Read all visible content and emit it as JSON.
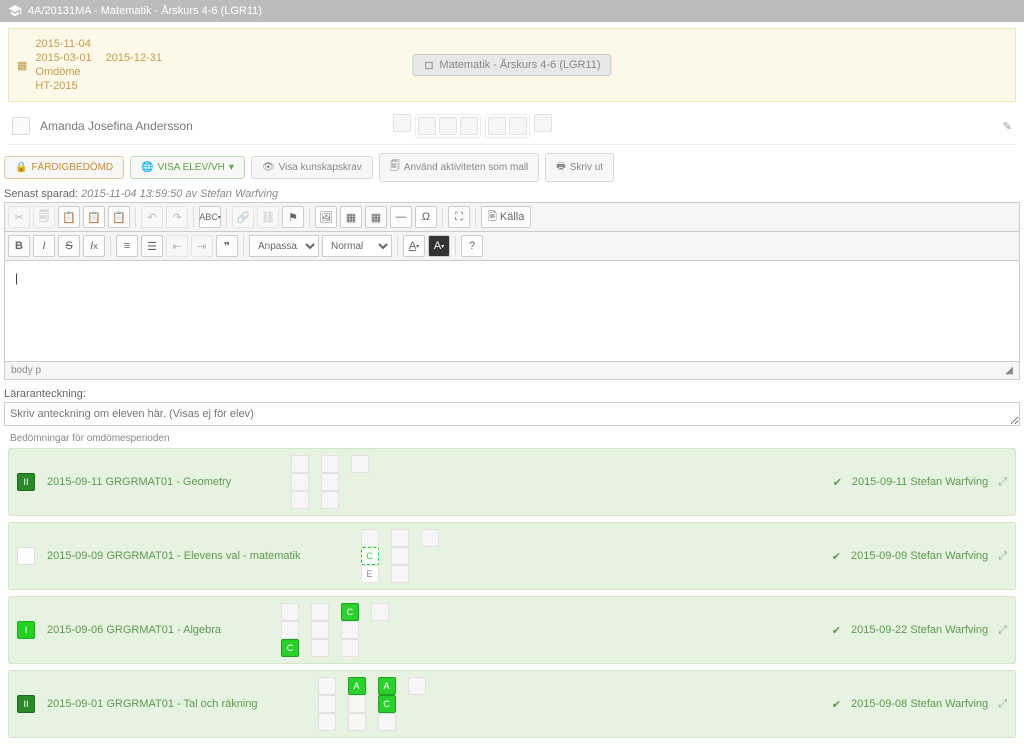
{
  "breadcrumb": "4A/20131MA - Matematik - Årskurs 4-6 (LGR11)",
  "info": {
    "line1": "2015-11-04",
    "line2a": "2015-03-01",
    "line2b": "2015-12-31",
    "line3": "Omdöme",
    "line4": "HT-2015",
    "subject": "Matematik - Årskurs 4-6 (LGR11)"
  },
  "student": {
    "name": "Amanda Josefina Andersson"
  },
  "buttons": {
    "done": "FÄRDIGBEDÖMD",
    "show": "VISA ELEV/VH",
    "reqs": "Visa kunskapskrav",
    "template": "Använd aktiviteten som mall",
    "print": "Skriv ut"
  },
  "saved": {
    "label": "Senast sparad:",
    "value": "2015-11-04 13:59:50 av Stefan Warfving"
  },
  "editor": {
    "content": "|",
    "styles_placeholder": "Anpassa...",
    "format_placeholder": "Normal",
    "source": "Källa",
    "path": "body   p"
  },
  "teacher_note": {
    "label": "Läraranteckning:",
    "placeholder": "Skriv anteckning om eleven här. (Visas ej för elev)"
  },
  "assessments": {
    "title": "Bedömningar för omdömesperioden",
    "items": [
      {
        "badge": "II",
        "badge_style": "green-dark",
        "title": "2015-09-11 GRGRMAT01 - Geometry",
        "meta": "2015-09-11 Stefan Warfving",
        "grades": [
          [
            "",
            "",
            ""
          ],
          [
            "",
            "",
            ""
          ],
          [
            ""
          ]
        ]
      },
      {
        "badge": "",
        "badge_style": "white",
        "title": "2015-09-09 GRGRMAT01 - Elevens val - matematik",
        "meta": "2015-09-09 Stefan Warfving",
        "grades": [
          [
            "",
            {
              "t": "C",
              "cls": "letter-c-dash"
            },
            {
              "t": "E",
              "cls": "letter-e"
            }
          ],
          [
            "",
            "",
            ""
          ],
          [
            ""
          ]
        ]
      },
      {
        "badge": "I",
        "badge_style": "green-bright",
        "title": "2015-09-06 GRGRMAT01 - Algebra",
        "meta": "2015-09-22 Stefan Warfving",
        "grades": [
          [
            "",
            "",
            {
              "t": "C",
              "cls": "letter-c"
            }
          ],
          [
            "",
            "",
            ""
          ],
          [
            {
              "t": "C",
              "cls": "letter-c"
            },
            "",
            ""
          ],
          [
            ""
          ]
        ]
      },
      {
        "badge": "II",
        "badge_style": "green-dark",
        "title": "2015-09-01 GRGRMAT01 - Tal och räkning",
        "meta": "2015-09-08 Stefan Warfving",
        "grades": [
          [
            "",
            "",
            ""
          ],
          [
            {
              "t": "A",
              "cls": "letter-a"
            },
            "",
            ""
          ],
          [
            {
              "t": "A",
              "cls": "letter-a"
            },
            {
              "t": "C",
              "cls": "letter-c"
            },
            ""
          ],
          [
            ""
          ]
        ]
      }
    ]
  }
}
